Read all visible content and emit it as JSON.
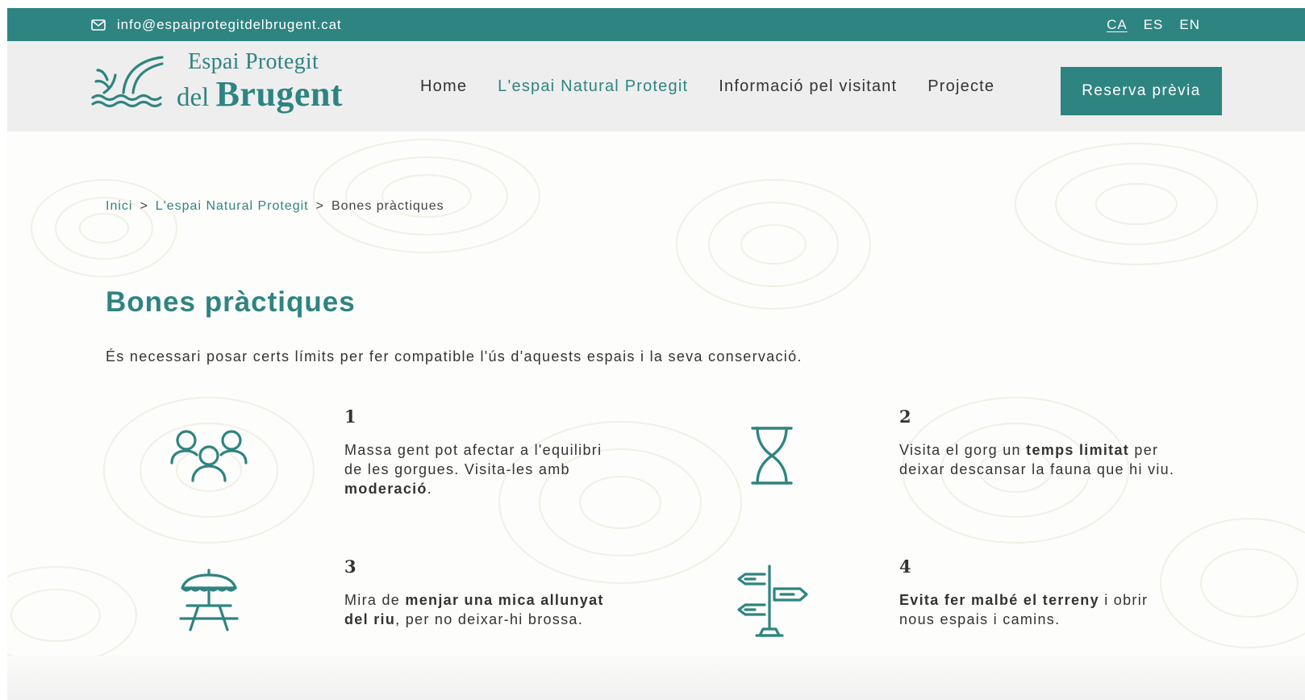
{
  "topbar": {
    "email": "info@espaiprotegitdelbrugent.cat",
    "email_icon": "envelope-icon",
    "languages": [
      "CA",
      "ES",
      "EN"
    ],
    "active_language": "CA"
  },
  "logo": {
    "line1": "Espai Protegit",
    "line2_small": "del",
    "line2_big": "Brugent"
  },
  "nav": {
    "items": [
      "Home",
      "L'espai Natural Protegit",
      "Informació pel visitant",
      "Projecte"
    ],
    "active": "L'espai Natural Protegit",
    "cta": "Reserva prèvia"
  },
  "breadcrumb": {
    "items": [
      "Inici",
      "L'espai Natural Protegit",
      "Bones pràctiques"
    ],
    "separator": ">"
  },
  "page": {
    "title": "Bones pràctiques",
    "intro": "És necessari posar certs límits per fer compatible l'ús d'aquests espais i la seva conservació."
  },
  "practices": [
    {
      "number": "1",
      "icon": "people-group-icon",
      "text": [
        {
          "t": "Massa gent pot afectar a l'equilibri de les gorgues. Visita-les amb ",
          "b": false
        },
        {
          "t": "moderació",
          "b": true
        },
        {
          "t": ".",
          "b": false
        }
      ]
    },
    {
      "number": "2",
      "icon": "hourglass-icon",
      "text": [
        {
          "t": "Visita el gorg un ",
          "b": false
        },
        {
          "t": "temps limitat",
          "b": true
        },
        {
          "t": " per deixar descansar la fauna que hi viu.",
          "b": false
        }
      ]
    },
    {
      "number": "3",
      "icon": "picnic-table-icon",
      "text": [
        {
          "t": "Mira de ",
          "b": false
        },
        {
          "t": "menjar una mica allunyat del riu",
          "b": true
        },
        {
          "t": ", per no deixar-hi brossa.",
          "b": false
        }
      ]
    },
    {
      "number": "4",
      "icon": "signpost-icon",
      "text": [
        {
          "t": "Evita fer malbé el terreny",
          "b": true
        },
        {
          "t": " i obrir nous espais i camins.",
          "b": false
        }
      ]
    }
  ],
  "colors": {
    "brand": "#2e8481",
    "text": "#333333",
    "header_bg": "#eeeeee"
  }
}
